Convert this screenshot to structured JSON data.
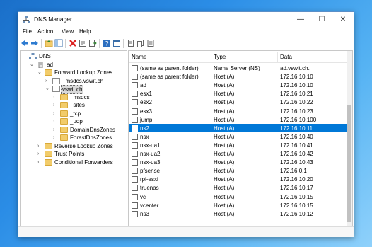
{
  "window": {
    "title": "DNS Manager",
    "controls": {
      "minimize": "—",
      "maximize": "☐",
      "close": "✕"
    }
  },
  "menu": [
    "File",
    "Action",
    "View",
    "Help"
  ],
  "toolbar": [
    "back-icon",
    "forward-icon",
    "up-folder-icon",
    "show-hide-tree-icon",
    "delete-icon",
    "properties-icon",
    "export-icon",
    "help-icon",
    "console-icon",
    "record-icon",
    "copy-icon",
    "list-icon"
  ],
  "tree": [
    {
      "label": "DNS",
      "depth": 0,
      "expander": "",
      "icon": "dns-icon"
    },
    {
      "label": "ad",
      "depth": 1,
      "expander": "⌄",
      "icon": "server-icon"
    },
    {
      "label": "Forward Lookup Zones",
      "depth": 2,
      "expander": "⌄",
      "icon": "folder-icon"
    },
    {
      "label": "_msdcs.vswit.ch",
      "depth": 3,
      "expander": "›",
      "icon": "zone-icon"
    },
    {
      "label": "vswit.ch",
      "depth": 3,
      "expander": "⌄",
      "icon": "zone-icon",
      "selected": true
    },
    {
      "label": "_msdcs",
      "depth": 4,
      "expander": "›",
      "icon": "folder-icon"
    },
    {
      "label": "_sites",
      "depth": 4,
      "expander": "›",
      "icon": "folder-icon"
    },
    {
      "label": "_tcp",
      "depth": 4,
      "expander": "›",
      "icon": "folder-icon"
    },
    {
      "label": "_udp",
      "depth": 4,
      "expander": "›",
      "icon": "folder-icon"
    },
    {
      "label": "DomainDnsZones",
      "depth": 4,
      "expander": "›",
      "icon": "folder-icon"
    },
    {
      "label": "ForestDnsZones",
      "depth": 4,
      "expander": "›",
      "icon": "folder-icon"
    },
    {
      "label": "Reverse Lookup Zones",
      "depth": 2,
      "expander": "›",
      "icon": "folder-icon"
    },
    {
      "label": "Trust Points",
      "depth": 2,
      "expander": "›",
      "icon": "folder-icon"
    },
    {
      "label": "Conditional Forwarders",
      "depth": 2,
      "expander": "›",
      "icon": "folder-icon"
    }
  ],
  "columns": [
    "Name",
    "Type",
    "Data"
  ],
  "records": [
    {
      "name": "(same as parent folder)",
      "type": "Name Server (NS)",
      "data": "ad.vswit.ch."
    },
    {
      "name": "(same as parent folder)",
      "type": "Host (A)",
      "data": "172.16.10.10"
    },
    {
      "name": "ad",
      "type": "Host (A)",
      "data": "172.16.10.10"
    },
    {
      "name": "esx1",
      "type": "Host (A)",
      "data": "172.16.10.21"
    },
    {
      "name": "esx2",
      "type": "Host (A)",
      "data": "172.16.10.22"
    },
    {
      "name": "esx3",
      "type": "Host (A)",
      "data": "172.16.10.23"
    },
    {
      "name": "jump",
      "type": "Host (A)",
      "data": "172.16.10.100"
    },
    {
      "name": "ns2",
      "type": "Host (A)",
      "data": "172.16.10.11",
      "selected": true
    },
    {
      "name": "nsx",
      "type": "Host (A)",
      "data": "172.16.10.40"
    },
    {
      "name": "nsx-ua1",
      "type": "Host (A)",
      "data": "172.16.10.41"
    },
    {
      "name": "nsx-ua2",
      "type": "Host (A)",
      "data": "172.16.10.42"
    },
    {
      "name": "nsx-ua3",
      "type": "Host (A)",
      "data": "172.16.10.43"
    },
    {
      "name": "pfsense",
      "type": "Host (A)",
      "data": "172.16.0.1"
    },
    {
      "name": "rpi-esxi",
      "type": "Host (A)",
      "data": "172.16.10.20"
    },
    {
      "name": "truenas",
      "type": "Host (A)",
      "data": "172.16.10.17"
    },
    {
      "name": "vc",
      "type": "Host (A)",
      "data": "172.16.10.15"
    },
    {
      "name": "vcenter",
      "type": "Host (A)",
      "data": "172.16.10.15"
    },
    {
      "name": "ns3",
      "type": "Host (A)",
      "data": "172.16.10.12"
    }
  ],
  "colors": {
    "selection": "#0078d7",
    "folder": "#f2cc6a"
  }
}
